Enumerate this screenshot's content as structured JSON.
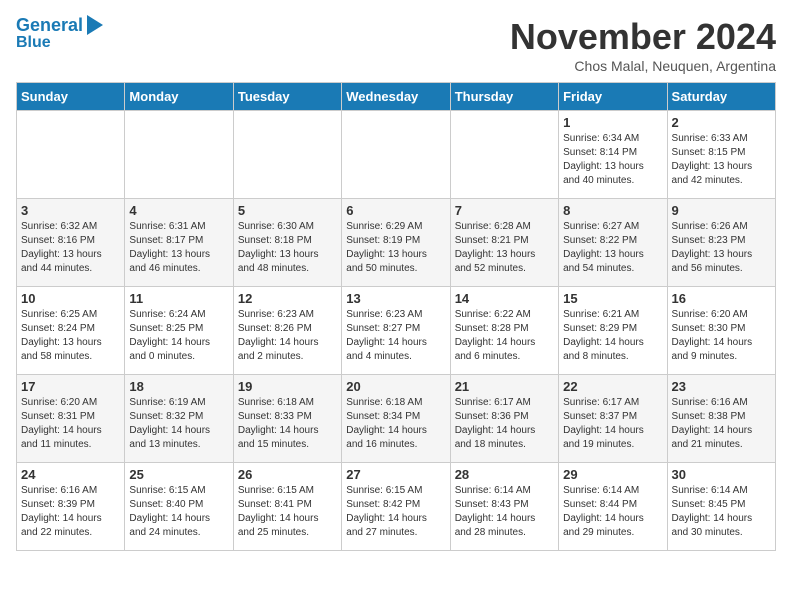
{
  "logo": {
    "line1": "General",
    "line2": "Blue"
  },
  "title": "November 2024",
  "subtitle": "Chos Malal, Neuquen, Argentina",
  "days_of_week": [
    "Sunday",
    "Monday",
    "Tuesday",
    "Wednesday",
    "Thursday",
    "Friday",
    "Saturday"
  ],
  "weeks": [
    [
      {
        "day": "",
        "detail": ""
      },
      {
        "day": "",
        "detail": ""
      },
      {
        "day": "",
        "detail": ""
      },
      {
        "day": "",
        "detail": ""
      },
      {
        "day": "",
        "detail": ""
      },
      {
        "day": "1",
        "detail": "Sunrise: 6:34 AM\nSunset: 8:14 PM\nDaylight: 13 hours\nand 40 minutes."
      },
      {
        "day": "2",
        "detail": "Sunrise: 6:33 AM\nSunset: 8:15 PM\nDaylight: 13 hours\nand 42 minutes."
      }
    ],
    [
      {
        "day": "3",
        "detail": "Sunrise: 6:32 AM\nSunset: 8:16 PM\nDaylight: 13 hours\nand 44 minutes."
      },
      {
        "day": "4",
        "detail": "Sunrise: 6:31 AM\nSunset: 8:17 PM\nDaylight: 13 hours\nand 46 minutes."
      },
      {
        "day": "5",
        "detail": "Sunrise: 6:30 AM\nSunset: 8:18 PM\nDaylight: 13 hours\nand 48 minutes."
      },
      {
        "day": "6",
        "detail": "Sunrise: 6:29 AM\nSunset: 8:19 PM\nDaylight: 13 hours\nand 50 minutes."
      },
      {
        "day": "7",
        "detail": "Sunrise: 6:28 AM\nSunset: 8:21 PM\nDaylight: 13 hours\nand 52 minutes."
      },
      {
        "day": "8",
        "detail": "Sunrise: 6:27 AM\nSunset: 8:22 PM\nDaylight: 13 hours\nand 54 minutes."
      },
      {
        "day": "9",
        "detail": "Sunrise: 6:26 AM\nSunset: 8:23 PM\nDaylight: 13 hours\nand 56 minutes."
      }
    ],
    [
      {
        "day": "10",
        "detail": "Sunrise: 6:25 AM\nSunset: 8:24 PM\nDaylight: 13 hours\nand 58 minutes."
      },
      {
        "day": "11",
        "detail": "Sunrise: 6:24 AM\nSunset: 8:25 PM\nDaylight: 14 hours\nand 0 minutes."
      },
      {
        "day": "12",
        "detail": "Sunrise: 6:23 AM\nSunset: 8:26 PM\nDaylight: 14 hours\nand 2 minutes."
      },
      {
        "day": "13",
        "detail": "Sunrise: 6:23 AM\nSunset: 8:27 PM\nDaylight: 14 hours\nand 4 minutes."
      },
      {
        "day": "14",
        "detail": "Sunrise: 6:22 AM\nSunset: 8:28 PM\nDaylight: 14 hours\nand 6 minutes."
      },
      {
        "day": "15",
        "detail": "Sunrise: 6:21 AM\nSunset: 8:29 PM\nDaylight: 14 hours\nand 8 minutes."
      },
      {
        "day": "16",
        "detail": "Sunrise: 6:20 AM\nSunset: 8:30 PM\nDaylight: 14 hours\nand 9 minutes."
      }
    ],
    [
      {
        "day": "17",
        "detail": "Sunrise: 6:20 AM\nSunset: 8:31 PM\nDaylight: 14 hours\nand 11 minutes."
      },
      {
        "day": "18",
        "detail": "Sunrise: 6:19 AM\nSunset: 8:32 PM\nDaylight: 14 hours\nand 13 minutes."
      },
      {
        "day": "19",
        "detail": "Sunrise: 6:18 AM\nSunset: 8:33 PM\nDaylight: 14 hours\nand 15 minutes."
      },
      {
        "day": "20",
        "detail": "Sunrise: 6:18 AM\nSunset: 8:34 PM\nDaylight: 14 hours\nand 16 minutes."
      },
      {
        "day": "21",
        "detail": "Sunrise: 6:17 AM\nSunset: 8:36 PM\nDaylight: 14 hours\nand 18 minutes."
      },
      {
        "day": "22",
        "detail": "Sunrise: 6:17 AM\nSunset: 8:37 PM\nDaylight: 14 hours\nand 19 minutes."
      },
      {
        "day": "23",
        "detail": "Sunrise: 6:16 AM\nSunset: 8:38 PM\nDaylight: 14 hours\nand 21 minutes."
      }
    ],
    [
      {
        "day": "24",
        "detail": "Sunrise: 6:16 AM\nSunset: 8:39 PM\nDaylight: 14 hours\nand 22 minutes."
      },
      {
        "day": "25",
        "detail": "Sunrise: 6:15 AM\nSunset: 8:40 PM\nDaylight: 14 hours\nand 24 minutes."
      },
      {
        "day": "26",
        "detail": "Sunrise: 6:15 AM\nSunset: 8:41 PM\nDaylight: 14 hours\nand 25 minutes."
      },
      {
        "day": "27",
        "detail": "Sunrise: 6:15 AM\nSunset: 8:42 PM\nDaylight: 14 hours\nand 27 minutes."
      },
      {
        "day": "28",
        "detail": "Sunrise: 6:14 AM\nSunset: 8:43 PM\nDaylight: 14 hours\nand 28 minutes."
      },
      {
        "day": "29",
        "detail": "Sunrise: 6:14 AM\nSunset: 8:44 PM\nDaylight: 14 hours\nand 29 minutes."
      },
      {
        "day": "30",
        "detail": "Sunrise: 6:14 AM\nSunset: 8:45 PM\nDaylight: 14 hours\nand 30 minutes."
      }
    ]
  ],
  "colors": {
    "header_bg": "#1a7ab5",
    "header_text": "#ffffff",
    "odd_row_bg": "#ffffff",
    "even_row_bg": "#f5f5f5"
  }
}
